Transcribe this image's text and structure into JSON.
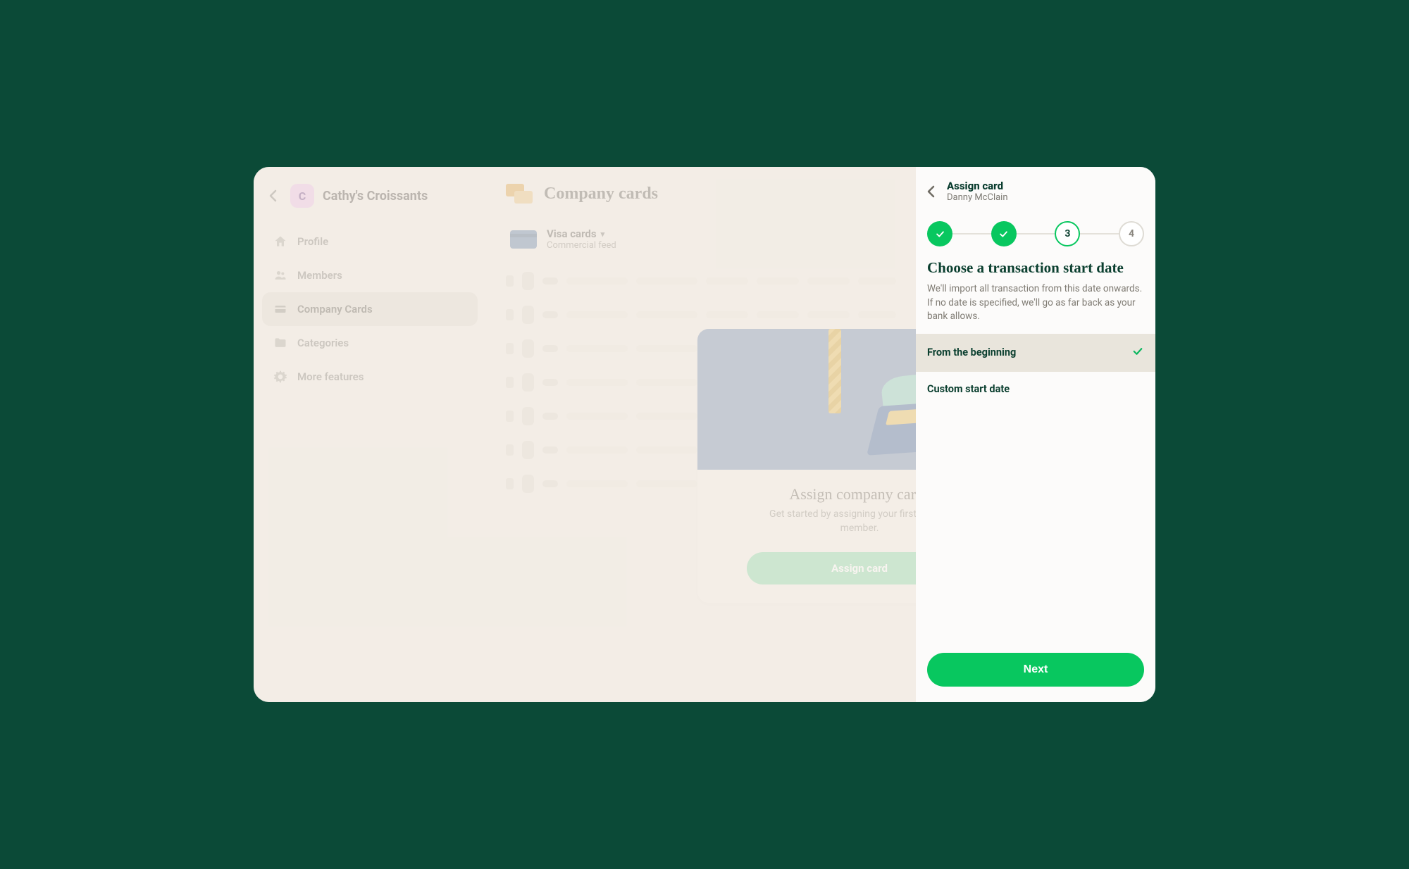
{
  "workspace": {
    "avatar_letter": "C",
    "name": "Cathy's Croissants"
  },
  "sidebar": {
    "items": [
      {
        "label": "Profile",
        "icon": "home-icon"
      },
      {
        "label": "Members",
        "icon": "people-icon"
      },
      {
        "label": "Company Cards",
        "icon": "card-icon"
      },
      {
        "label": "Categories",
        "icon": "folder-icon"
      },
      {
        "label": "More features",
        "icon": "gear-icon"
      }
    ],
    "active_index": 2
  },
  "main": {
    "title": "Company cards",
    "feed": {
      "name": "Visa cards",
      "subtitle": "Commercial feed"
    }
  },
  "empty_state": {
    "title": "Assign company cards",
    "subtitle_a": "Get started by assigning your first card to",
    "subtitle_b": "member.",
    "button": "Assign card"
  },
  "panel": {
    "title": "Assign card",
    "subtitle": "Danny McClain",
    "steps": {
      "count": 4,
      "completed": 2,
      "current": 3,
      "step3_label": "3",
      "step4_label": "4"
    },
    "section_title": "Choose a transaction start date",
    "description": "We'll import all transaction from this date onwards. If no date is specified, we'll go as far back as your bank allows.",
    "options": [
      {
        "label": "From the beginning",
        "selected": true
      },
      {
        "label": "Custom start date",
        "selected": false
      }
    ],
    "next_button": "Next"
  }
}
